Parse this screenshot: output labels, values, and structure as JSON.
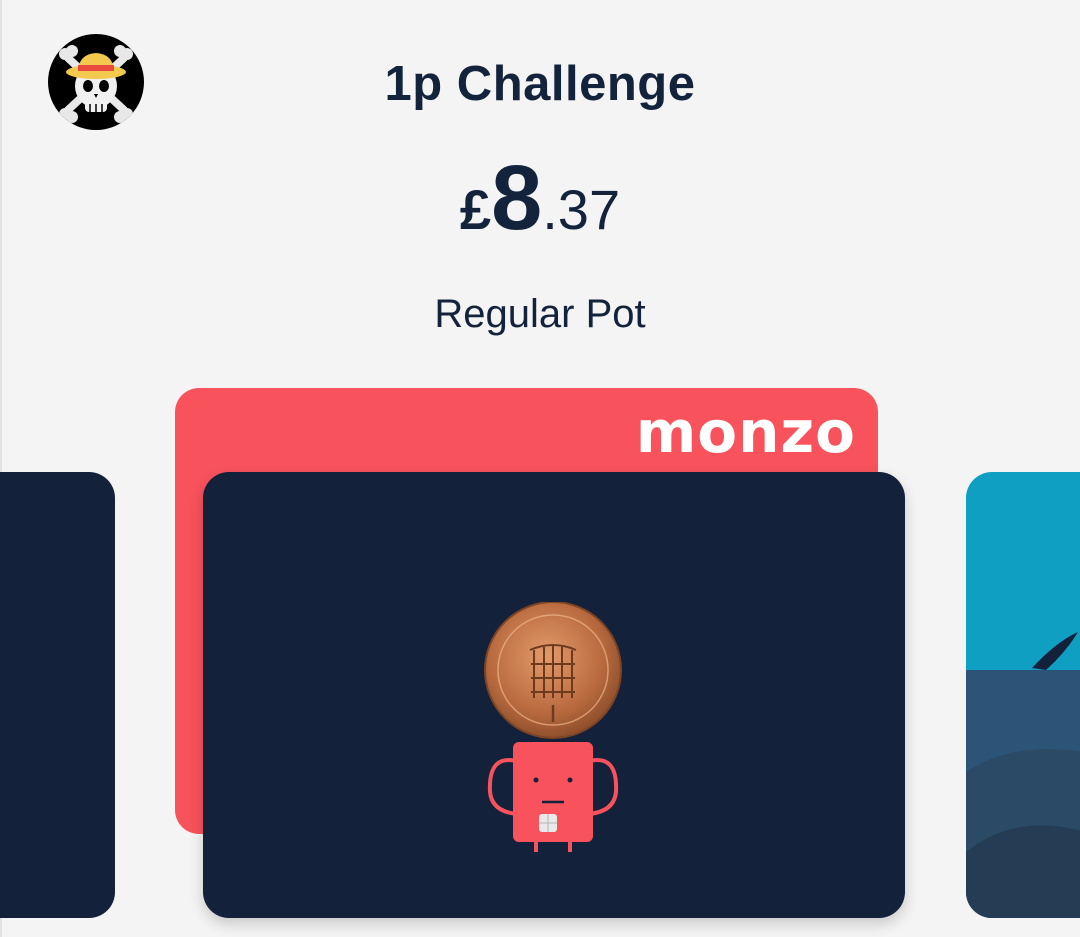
{
  "header": {
    "avatar_icon": "straw-hat-jolly-roger-icon"
  },
  "pot": {
    "name": "1p Challenge",
    "currency": "£",
    "amount_major": "8",
    "amount_minor": ".37",
    "type": "Regular Pot"
  },
  "cards": {
    "back_card_brand": "monzo",
    "main_card_illustration": "penny-coin-character-icon",
    "previous_card_color": "#14213b",
    "next_card_color": "#0e9fc2"
  },
  "colors": {
    "accent": "#f8525c",
    "navy": "#14213b",
    "text": "#14233c",
    "background": "#f4f4f4"
  }
}
